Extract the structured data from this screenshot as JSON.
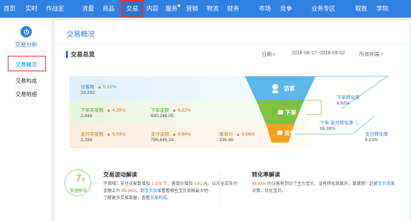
{
  "nav": {
    "items": [
      {
        "label": "首页"
      },
      {
        "label": "实时"
      },
      {
        "label": "作战室"
      },
      {
        "label": "流量"
      },
      {
        "label": "商品"
      },
      {
        "label": "交易"
      },
      {
        "label": "内容"
      },
      {
        "label": "服务"
      },
      {
        "label": "营销"
      },
      {
        "label": "物流"
      },
      {
        "label": "财务"
      },
      {
        "label": "市场"
      },
      {
        "label": "竞争"
      },
      {
        "label": "业务专区"
      },
      {
        "label": "取数"
      },
      {
        "label": "学院"
      }
    ],
    "active": "交易"
  },
  "sidebar": {
    "title": "交易分析",
    "items": [
      {
        "label": "交易概况"
      },
      {
        "label": "交易构成"
      },
      {
        "label": "交易明细"
      }
    ]
  },
  "main": {
    "title": "交易概况",
    "panel_title": "交易总览",
    "date_label": "日期",
    "date_range": "2018-08-27~2018-09-02",
    "terminal_label": "所有终端"
  },
  "metrics": {
    "visitors": {
      "label": "访客数",
      "change": "5.31%",
      "value": "28,392"
    },
    "order_buyers": {
      "label": "下单买家数",
      "change": "4.39%",
      "value": "2,448"
    },
    "order_amount": {
      "label": "下单金额",
      "change": "6.22%",
      "value": "890,246.05"
    },
    "pay_buyers": {
      "label": "支付买家数",
      "change": "5.03%",
      "value": "2,338"
    },
    "pay_amount": {
      "label": "支付金额",
      "change": "6.04%",
      "value": "786,646.34"
    },
    "unit_price": {
      "label": "客单价",
      "change": "0.96%",
      "value": "336.46"
    }
  },
  "funnel": {
    "visit": "访客",
    "order": "下单",
    "pay": "支付"
  },
  "rates": {
    "order_rate": {
      "label": "下单转化率",
      "value": "8.62%"
    },
    "order_pay_rate": {
      "label": "下单-支付转化率",
      "value": "95.38%"
    },
    "pay_rate": {
      "label": "支付转化率",
      "value": "8.23%"
    }
  },
  "interpret": {
    "days": "7",
    "days_unit": "天",
    "days_label": "数据解读",
    "title": "交易波动解读",
    "line1_a": "不错哦！支付买家数增加",
    "line1_b": "1,106",
    "line1_c": "个，客单价增加",
    "line1_d": "3.81",
    "line1_e": "元，拉升全店支付",
    "line2_a": "金额上升",
    "line2_b": "69.34%",
    "line2_c": "，到",
    "line2_d": "宝贝效果",
    "line2_e": "看看哪些宝贝贡献最大吧~",
    "line3_a": "了解更多交易数据，查看",
    "line3_b": "交易构成",
    "line3_c": "。"
  },
  "conversion": {
    "title": "转化率解读",
    "line1_a": "96.93%",
    "line1_b": "的访客有到访了主力宝贝，没有转化就离开，真遗憾！赶紧",
    "line1_c": "宝贝效果",
    "line2": "详情，优化宝贝。"
  }
}
